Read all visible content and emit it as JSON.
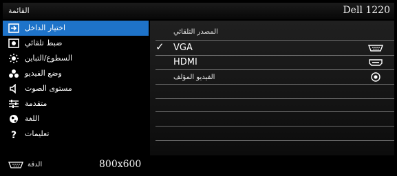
{
  "header": {
    "menu_title": "القائمة",
    "model": "Dell 1220"
  },
  "sidebar": {
    "items": [
      {
        "label": "اختيار الداخل",
        "icon": "input-select-icon",
        "selected": true
      },
      {
        "label": "ضبط تلقائي",
        "icon": "auto-adjust-icon",
        "selected": false
      },
      {
        "label": "السطوع/التباين",
        "icon": "brightness-icon",
        "selected": false
      },
      {
        "label": "وضع الفيديو",
        "icon": "video-mode-icon",
        "selected": false
      },
      {
        "label": "مستوى الصوت",
        "icon": "volume-icon",
        "selected": false
      },
      {
        "label": "متقدمة",
        "icon": "advanced-settings-icon",
        "selected": false
      },
      {
        "label": "اللغة",
        "icon": "language-globe-icon",
        "selected": false
      },
      {
        "label": "تعليمات",
        "icon": "help-icon",
        "selected": false
      }
    ]
  },
  "panel": {
    "auto_source_label": "المصدر التلقائي",
    "options": [
      {
        "label": "VGA",
        "checked": true,
        "icon": "vga-port-icon"
      },
      {
        "label": "HDMI",
        "checked": false,
        "icon": "hdmi-port-icon"
      },
      {
        "label": "الفيديو المؤلف",
        "checked": false,
        "icon": "composite-video-icon"
      }
    ]
  },
  "status": {
    "resolution_label": "الدقة",
    "resolution_value": "800x600"
  }
}
